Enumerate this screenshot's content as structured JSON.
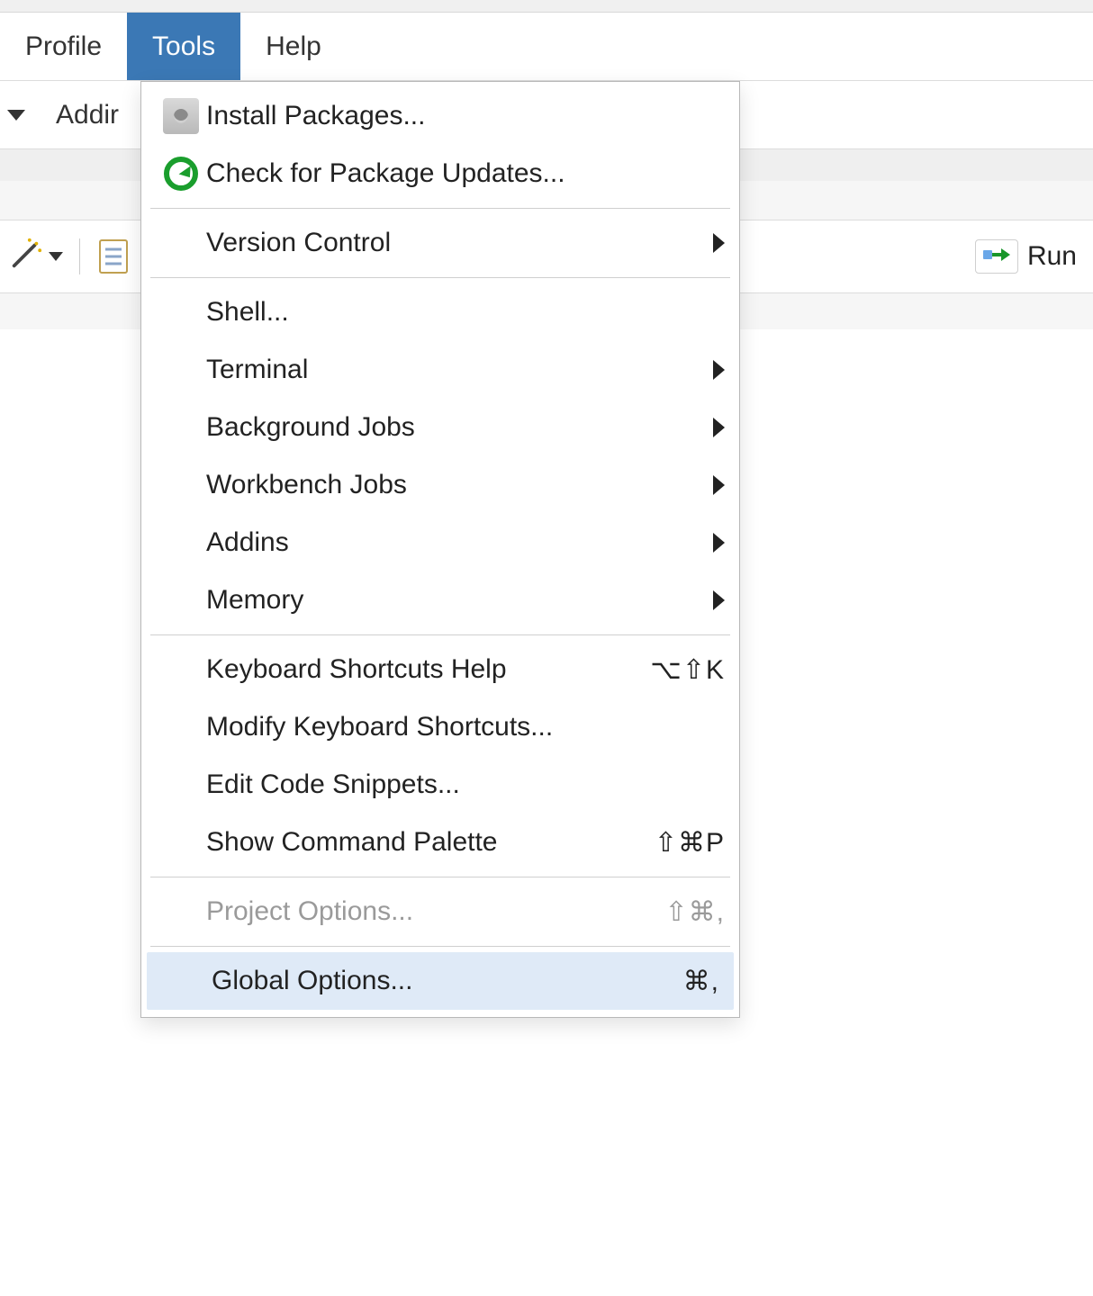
{
  "menubar": {
    "profile": "Profile",
    "tools": "Tools",
    "help": "Help"
  },
  "toolbar": {
    "addins_label": "Addir"
  },
  "editor_toolbar": {
    "run_label": "Run"
  },
  "tools_menu": {
    "install_packages": "Install Packages...",
    "check_updates": "Check for Package Updates...",
    "version_control": "Version Control",
    "shell": "Shell...",
    "terminal": "Terminal",
    "background_jobs": "Background Jobs",
    "workbench_jobs": "Workbench Jobs",
    "addins": "Addins",
    "memory": "Memory",
    "keyboard_shortcuts_help": "Keyboard Shortcuts Help",
    "keyboard_shortcuts_help_shortcut": "⌥⇧K",
    "modify_shortcuts": "Modify Keyboard Shortcuts...",
    "edit_snippets": "Edit Code Snippets...",
    "command_palette": "Show Command Palette",
    "command_palette_shortcut": "⇧⌘P",
    "project_options": "Project Options...",
    "project_options_shortcut": "⇧⌘,",
    "global_options": "Global Options...",
    "global_options_shortcut": "⌘,"
  }
}
